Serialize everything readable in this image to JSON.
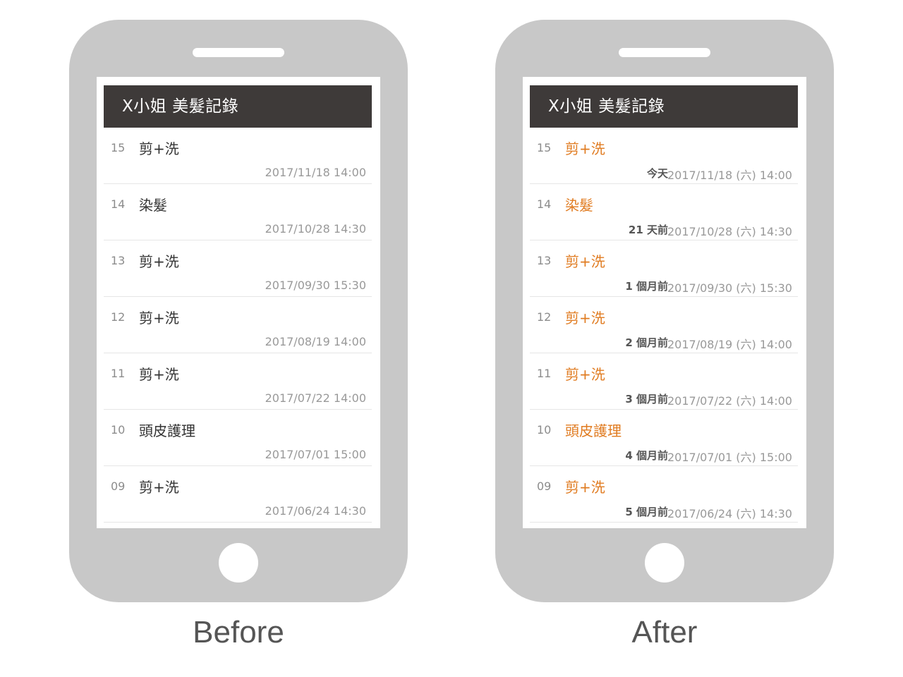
{
  "header_title": "X小姐 美髮記錄",
  "captions": {
    "before": "Before",
    "after": "After"
  },
  "before_rows": [
    {
      "num": "15",
      "service": "剪+洗",
      "date": "2017/11/18 14:00"
    },
    {
      "num": "14",
      "service": "染髮",
      "date": "2017/10/28 14:30"
    },
    {
      "num": "13",
      "service": "剪+洗",
      "date": "2017/09/30 15:30"
    },
    {
      "num": "12",
      "service": "剪+洗",
      "date": "2017/08/19 14:00"
    },
    {
      "num": "11",
      "service": "剪+洗",
      "date": "2017/07/22 14:00"
    },
    {
      "num": "10",
      "service": "頭皮護理",
      "date": "2017/07/01 15:00"
    },
    {
      "num": "09",
      "service": "剪+洗",
      "date": "2017/06/24 14:30"
    }
  ],
  "after_rows": [
    {
      "num": "15",
      "service": "剪+洗",
      "relative": "今天",
      "date": "2017/11/18 (六) 14:00"
    },
    {
      "num": "14",
      "service": "染髮",
      "relative": "21 天前",
      "date": "2017/10/28 (六) 14:30"
    },
    {
      "num": "13",
      "service": "剪+洗",
      "relative": "1 個月前",
      "date": "2017/09/30 (六) 15:30"
    },
    {
      "num": "12",
      "service": "剪+洗",
      "relative": "2 個月前",
      "date": "2017/08/19 (六) 14:00"
    },
    {
      "num": "11",
      "service": "剪+洗",
      "relative": "3 個月前",
      "date": "2017/07/22 (六) 14:00"
    },
    {
      "num": "10",
      "service": "頭皮護理",
      "relative": "4 個月前",
      "date": "2017/07/01 (六) 15:00"
    },
    {
      "num": "09",
      "service": "剪+洗",
      "relative": "5 個月前",
      "date": "2017/06/24 (六) 14:30"
    }
  ],
  "colors": {
    "header_bg": "#3e3a39",
    "phone_body": "#c8c8c8",
    "service_after": "#e07b20"
  }
}
